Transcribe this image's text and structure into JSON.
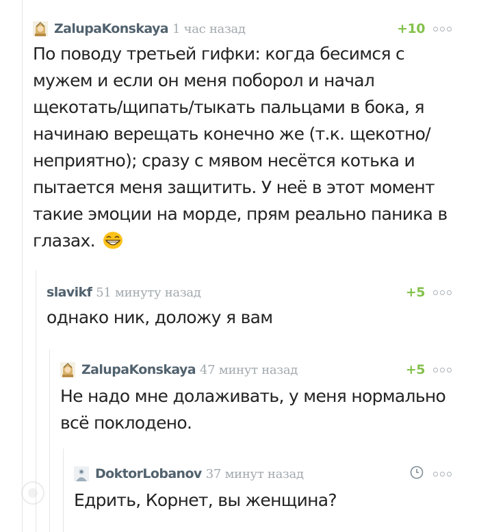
{
  "comments": [
    {
      "author": "ZalupaKonskaya",
      "time": "1 час назад",
      "rating": "+10",
      "body": "По поводу третьей гифки: когда бесимся с мужем и если он меня поборол и начал щекотать/щипать/тыкать пальцами в бока, я начинаю верещать конечно же (т.к. щекотно/неприятно); сразу с мявом несётся котька и пытается меня защитить. У неё в этот момент такие эмоции на морде, прям реально паника в глазах."
    },
    {
      "author": "slavikf",
      "time": "51 минуту назад",
      "rating": "+5",
      "body": "однако ник, доложу я вам"
    },
    {
      "author": "ZalupaKonskaya",
      "time": "47 минут назад",
      "rating": "+5",
      "body": "Не надо мне долаживать, у меня нормально всё поклодено."
    },
    {
      "author": "DoktorLobanov",
      "time": "37 минут назад",
      "rating_icon": "clock-icon",
      "body": "Едрить, Корнет, вы женщина?"
    }
  ],
  "icons": {
    "emoji": "grinning-face-icon",
    "more": "more-dots-icon"
  },
  "colors": {
    "author": "#51626e",
    "time": "#a2a9ae",
    "rating": "#84c14c",
    "body": "#232323",
    "indent_line": "#e6e6e6"
  }
}
